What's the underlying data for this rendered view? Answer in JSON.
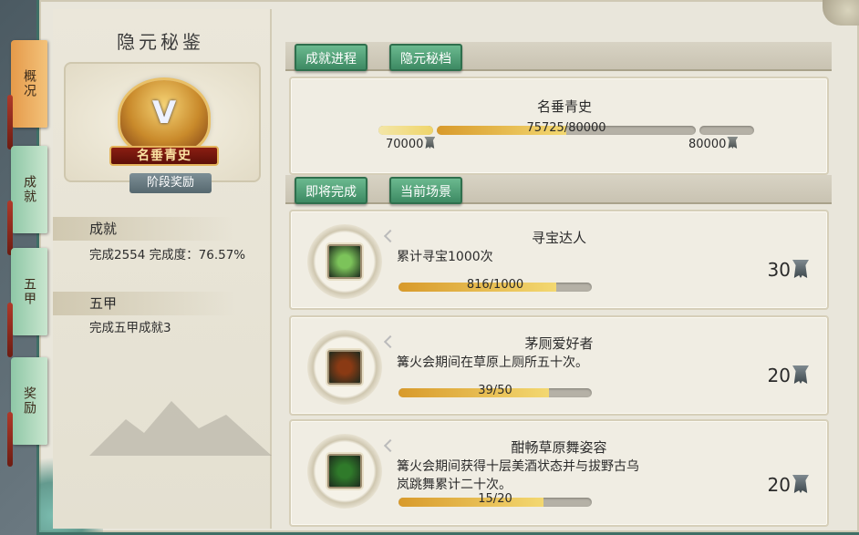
{
  "side_tabs": [
    {
      "label": "概况",
      "active": true
    },
    {
      "label": "成就",
      "active": false
    },
    {
      "label": "五甲",
      "active": false
    },
    {
      "label": "奖励",
      "active": false
    }
  ],
  "left": {
    "title": "隐元秘鉴",
    "emblem_letter": "V",
    "emblem_banner": "名垂青史",
    "stage_reward_button": "阶段奖励",
    "achievement_head": "成就",
    "achievement_line": "完成2554  完成度：76.57%",
    "wujia_head": "五甲",
    "wujia_line": "完成五甲成就3"
  },
  "top_tabs": [
    "成就进程",
    "隐元秘档"
  ],
  "progress": {
    "title": "名垂青史",
    "current": "75725/80000",
    "current_fraction": 0.5,
    "left_label": "70000",
    "right_label": "80000"
  },
  "mid_tabs": [
    "即将完成",
    "当前场景"
  ],
  "achievements": [
    {
      "title": "寻宝达人",
      "desc": "累计寻宝1000次",
      "progress": "816/1000",
      "fraction": 0.816,
      "reward": "30",
      "icon": "yin-yang-icon",
      "icon_color": "#7cc35a"
    },
    {
      "title": "茅厕爱好者",
      "desc": "篝火会期间在草原上厕所五十次。",
      "progress": "39/50",
      "fraction": 0.78,
      "reward": "20",
      "icon": "flame-figure-icon",
      "icon_color": "#8a3a14"
    },
    {
      "title": "酣畅草原舞姿容",
      "desc": "篝火会期间获得十层美酒状态并与拔野古乌\n岚跳舞累计二十次。",
      "progress": "15/20",
      "fraction": 0.75,
      "reward": "20",
      "icon": "dancer-icon",
      "icon_color": "#2f7a2a"
    }
  ]
}
